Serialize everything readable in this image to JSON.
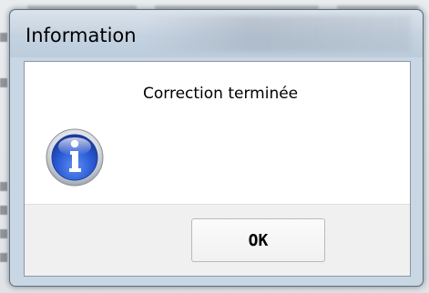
{
  "dialog": {
    "title": "Information",
    "message": "Correction terminée",
    "icon": "info-icon",
    "ok_label": "OK"
  },
  "colors": {
    "titlebar": "#c4d2e0",
    "client_bg": "#ffffff",
    "footer_bg": "#f0f0f0",
    "icon_blue": "#2a5bd7"
  }
}
